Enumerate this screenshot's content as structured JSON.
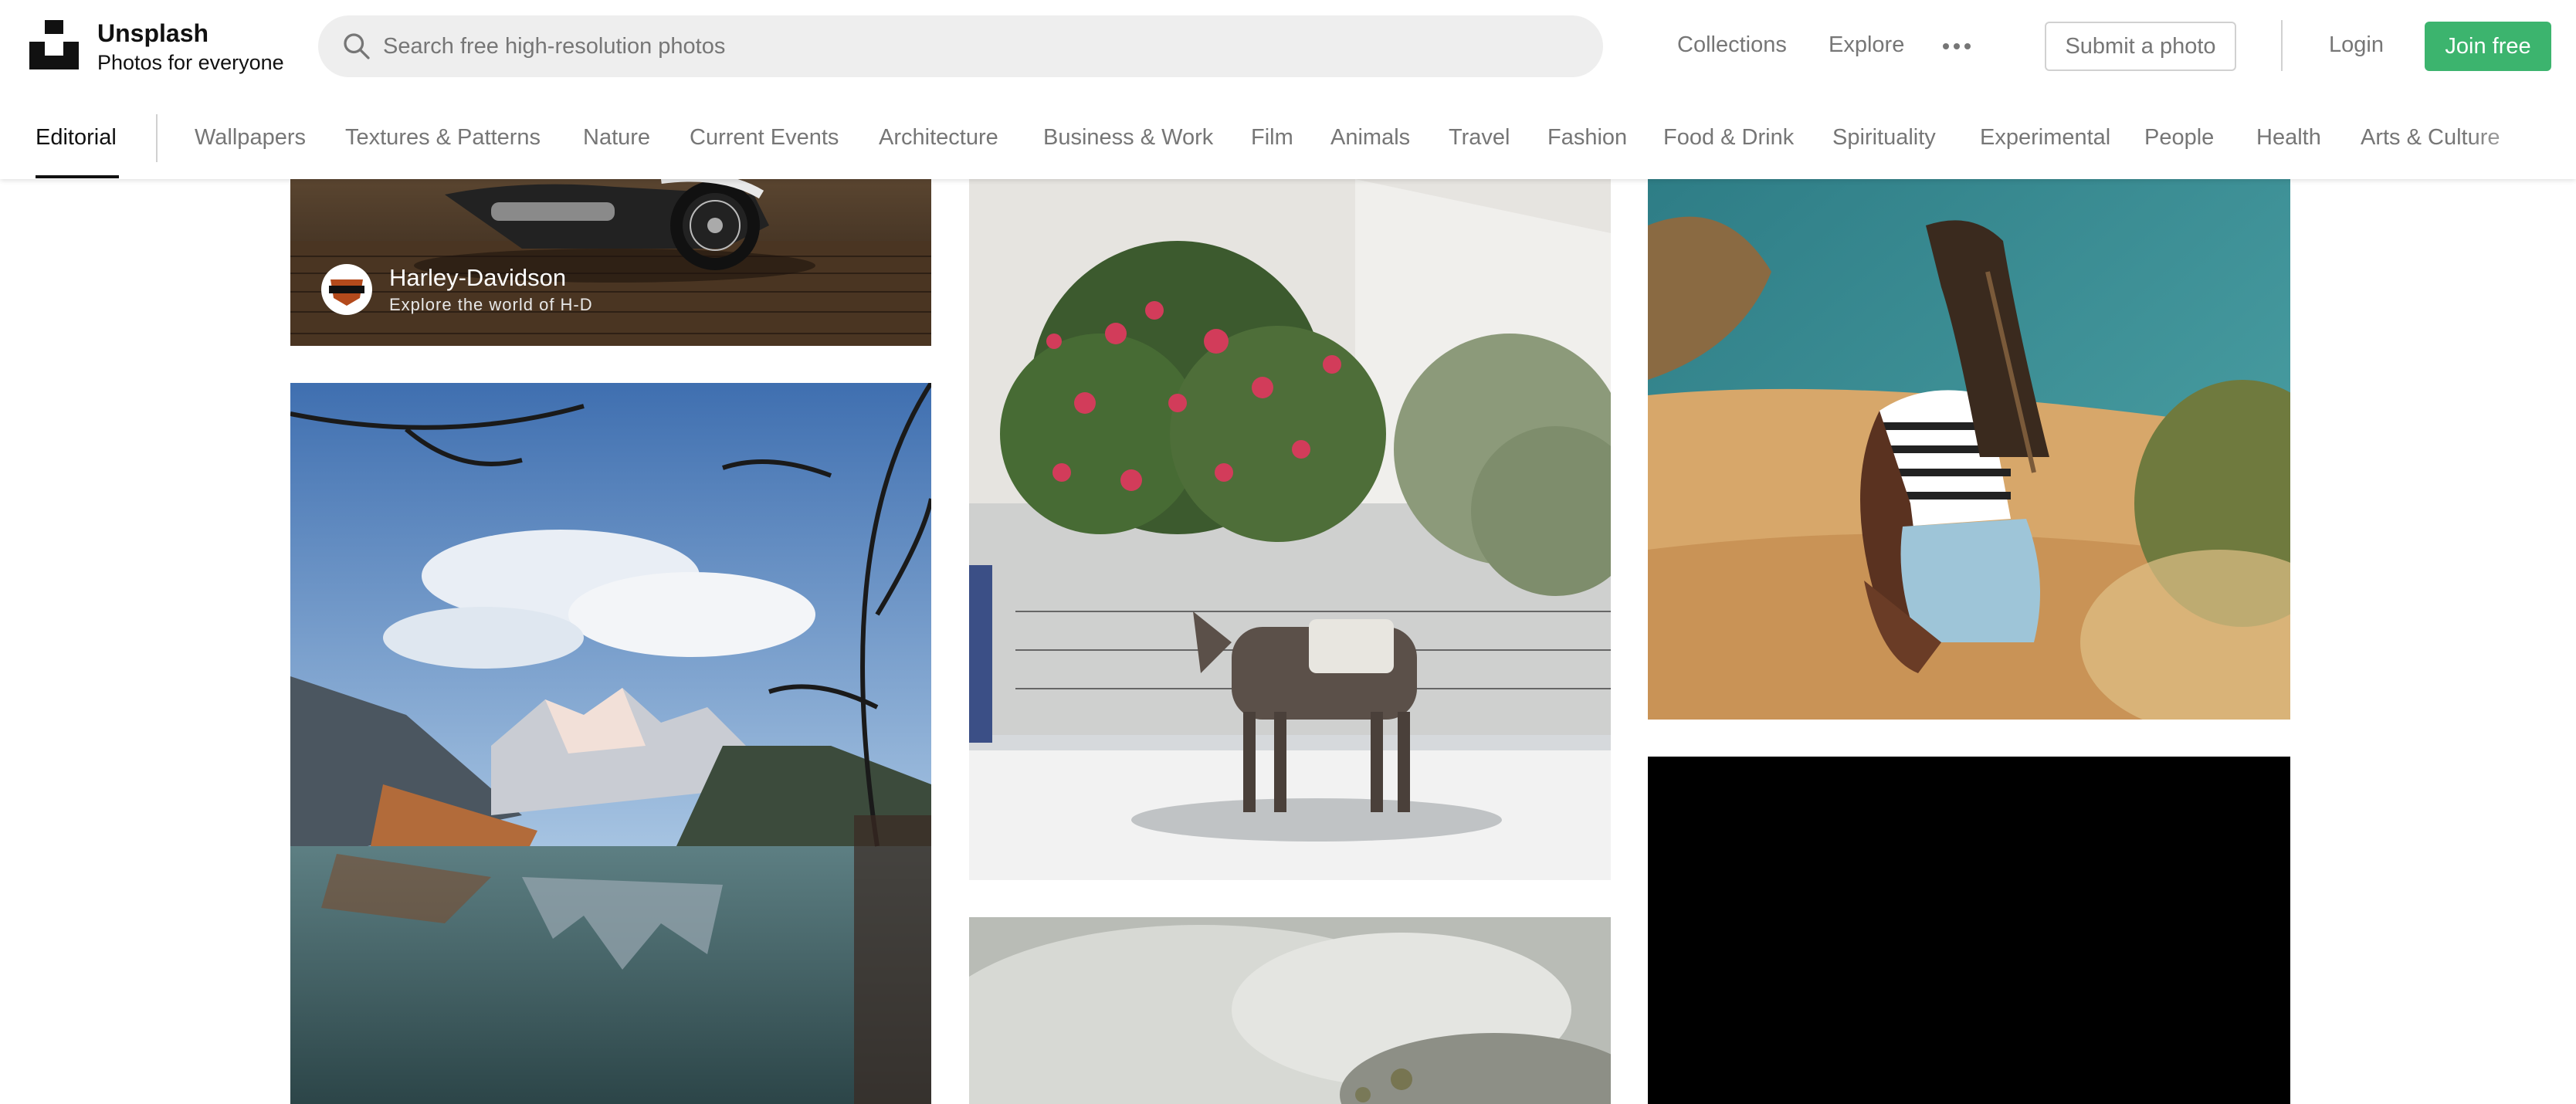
{
  "header": {
    "brand_name": "Unsplash",
    "brand_tagline": "Photos for everyone",
    "search_placeholder": "Search free high-resolution photos",
    "nav": [
      "Collections",
      "Explore"
    ],
    "submit_label": "Submit a photo",
    "login_label": "Login",
    "join_label": "Join free",
    "join_color": "#3cb46e"
  },
  "topics": {
    "active": "Editorial",
    "items": [
      "Wallpapers",
      "Textures & Patterns",
      "Nature",
      "Current Events",
      "Architecture",
      "Business & Work",
      "Film",
      "Animals",
      "Travel",
      "Fashion",
      "Food & Drink",
      "Spirituality",
      "Experimental",
      "People",
      "Health",
      "Arts & Culture"
    ]
  },
  "photos": {
    "sponsored": {
      "name": "Harley-Davidson",
      "tagline": "Explore the world of H-D"
    }
  },
  "icons": [
    "unsplash-logo",
    "search-icon",
    "more-icon",
    "harley-davidson-logo"
  ]
}
